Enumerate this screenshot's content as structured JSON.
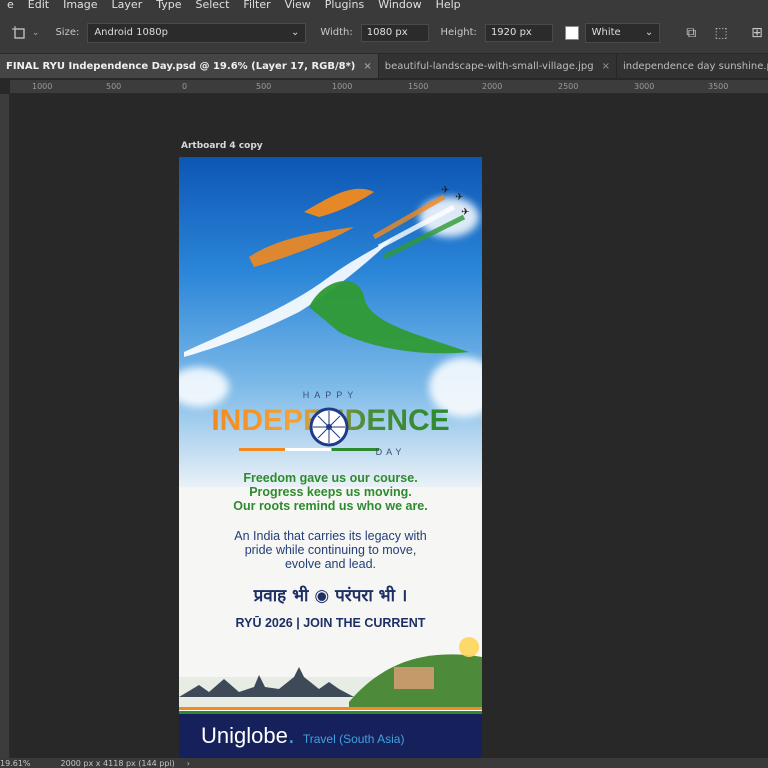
{
  "menu": [
    "e",
    "Edit",
    "Image",
    "Layer",
    "Type",
    "Select",
    "Filter",
    "View",
    "Plugins",
    "Window",
    "Help"
  ],
  "options": {
    "size_label": "Size:",
    "size_value": "Android 1080p",
    "width_label": "Width:",
    "width_value": "1080 px",
    "height_label": "Height:",
    "height_value": "1920 px",
    "fill_value": "White"
  },
  "tabs": [
    {
      "label": "FINAL RYU Independence Day.psd @ 19.6% (Layer 17, RGB/8*)",
      "close": "×"
    },
    {
      "label": "beautiful-landscape-with-small-village.jpg",
      "close": "×"
    },
    {
      "label": "independence day sunshine.psd @",
      "close": ""
    }
  ],
  "ruler_h": [
    "1000",
    "500",
    "0",
    "500",
    "1000",
    "1500",
    "2000",
    "2500",
    "3000",
    "3500"
  ],
  "artboard": {
    "label": "Artboard 4 copy",
    "happy": "HAPPY",
    "independence": "INDEPENDENCE",
    "day": "DAY",
    "green_line1": "Freedom gave us our course.",
    "green_line2": "Progress keeps us moving.",
    "green_line3": "Our roots remind us who we are.",
    "blue_line1": "An India that carries its legacy with",
    "blue_line2": "pride while continuing to move,",
    "blue_line3": "evolve and lead.",
    "hindi": "प्रवाह भी ◉ परंपरा भी ।",
    "tagline": "RYŪ 2026 | JOIN THE CURRENT",
    "brand": "Uniglobe",
    "brand_dot": ".",
    "brand_sub": "Travel (South Asia)"
  },
  "status": {
    "zoom": "19.61%",
    "doc_info": "2000 px x 4118 px (144 ppi)"
  },
  "colors": {
    "saffron": "#f28a1e",
    "green": "#2e8a2e",
    "navy": "#16205a",
    "accent_blue": "#3fa3e0"
  }
}
